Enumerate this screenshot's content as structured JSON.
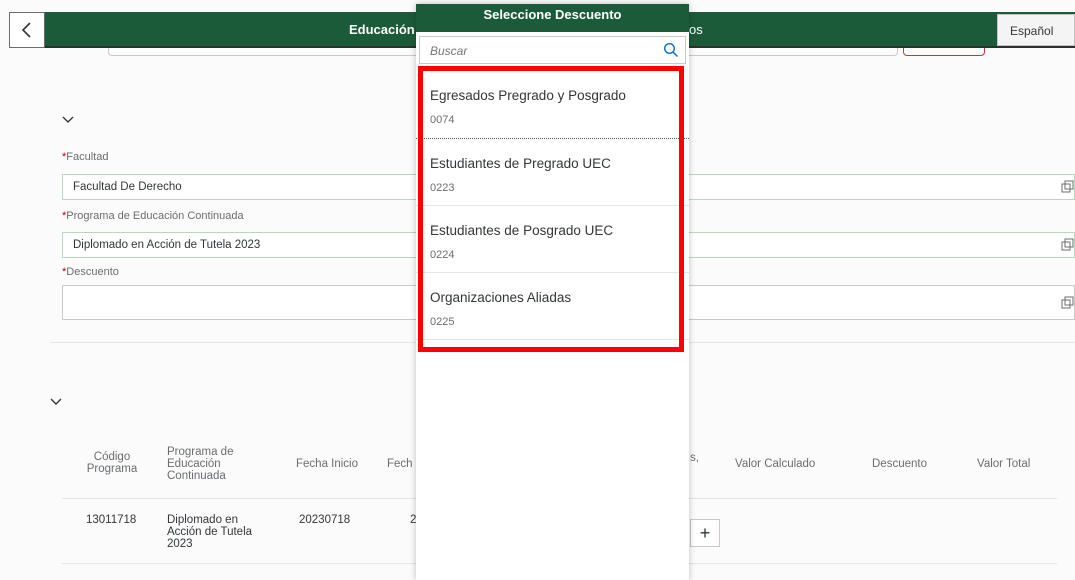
{
  "header": {
    "title_left": "Educación C",
    "title_right": "os",
    "language": "Español"
  },
  "form": {
    "faculty_label": "Facultad",
    "faculty_value": "Facultad De Derecho",
    "program_label": "Programa de Educación Continuada",
    "program_value": "Diplomado en Acción de Tutela 2023",
    "discount_label": "Descuento",
    "discount_value": "",
    "required_mark": "*"
  },
  "table": {
    "headers": {
      "codigo": "Código Programa",
      "programa": "Programa de Educación Continuada",
      "fecha_inicio": "Fecha Inicio",
      "fecha_fin": "Fech",
      "partial": "s,",
      "valor_calculado": "Valor Calculado",
      "descuento": "Descuento",
      "valor_total": "Valor Total"
    },
    "rows": [
      {
        "codigo": "13011718",
        "programa": "Diplomado en Acción de Tutela 2023",
        "fecha_inicio": "20230718",
        "fecha_fin_partial": "2"
      }
    ],
    "add_label": "+"
  },
  "dialog": {
    "title": "Seleccione Descuento",
    "search_placeholder": "Buscar",
    "items": [
      {
        "title": "Egresados Pregrado y Posgrado",
        "code": "0074"
      },
      {
        "title": "Estudiantes de Pregrado UEC",
        "code": "0223"
      },
      {
        "title": "Estudiantes de Posgrado UEC",
        "code": "0224"
      },
      {
        "title": "Organizaciones Aliadas",
        "code": "0225"
      }
    ]
  },
  "colors": {
    "brand_green": "#1c5b3a",
    "highlight_red": "#ff0000",
    "required_red": "#bb0000"
  }
}
